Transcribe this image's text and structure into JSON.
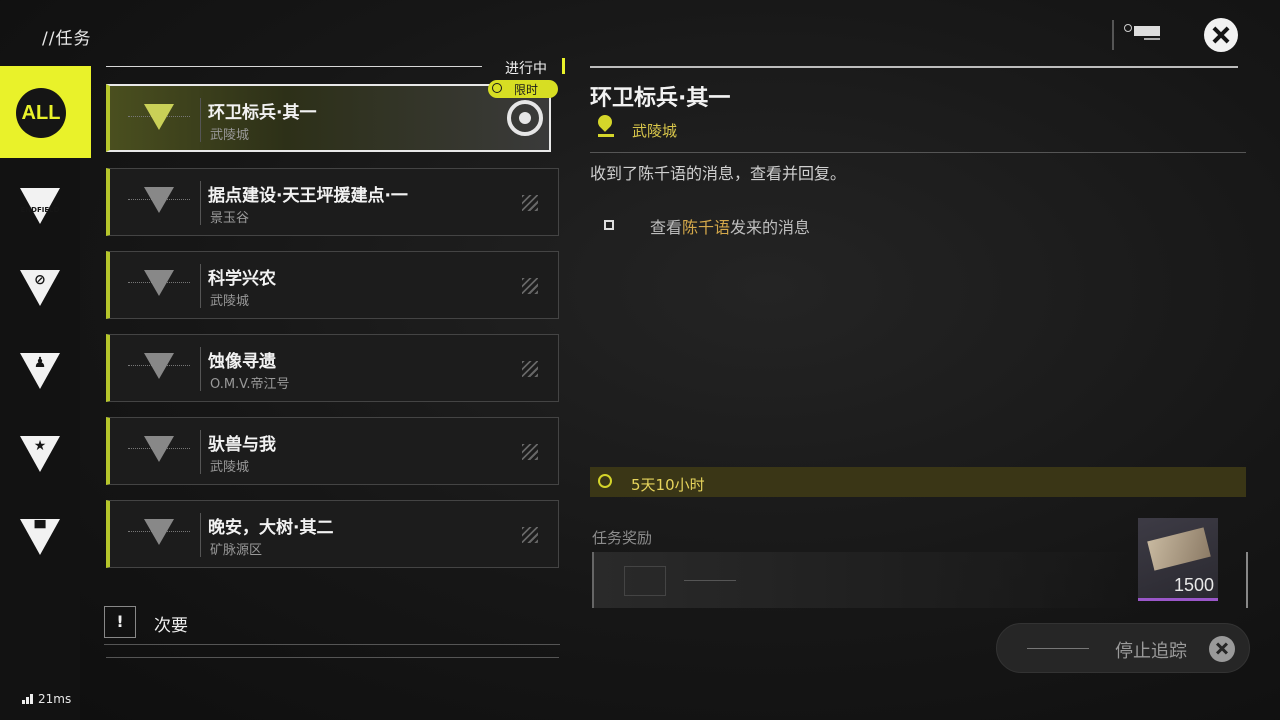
{
  "header": {
    "title": "//任务"
  },
  "sidebar": {
    "all_label": "ALL",
    "items": [
      {
        "name": "endfield",
        "label": "ENDFIELD"
      },
      {
        "name": "region",
        "label": ""
      },
      {
        "name": "character",
        "label": ""
      },
      {
        "name": "star",
        "label": ""
      },
      {
        "name": "facility",
        "label": ""
      }
    ]
  },
  "quest_list": {
    "status_label": "进行中",
    "limited_badge": "限时",
    "quests": [
      {
        "title": "环卫标兵·其一",
        "location": "武陵城",
        "active": true
      },
      {
        "title": "据点建设·天王坪援建点·一",
        "location": "景玉谷"
      },
      {
        "title": "科学兴农",
        "location": "武陵城"
      },
      {
        "title": "蚀像寻遗",
        "location": "O.M.V.帝江号"
      },
      {
        "title": "驮兽与我",
        "location": "武陵城"
      },
      {
        "title": "晚安，大树·其二",
        "location": "矿脉源区"
      }
    ],
    "secondary_icon": "!",
    "secondary_label": "次要"
  },
  "detail": {
    "title": "环卫标兵·其一",
    "location": "武陵城",
    "description": "收到了陈千语的消息，查看并回复。",
    "objective_prefix": "查看",
    "objective_highlight": "陈千语",
    "objective_suffix": "发来的消息",
    "timer": "5天10小时",
    "reward_label": "任务奖励",
    "reward_quantity": "1500",
    "stop_tracking": "停止追踪"
  },
  "net": {
    "ping": "21ms"
  },
  "colors": {
    "accent": "#e9f22a",
    "highlight": "#d4a84a",
    "rare": "#9a57c9"
  }
}
